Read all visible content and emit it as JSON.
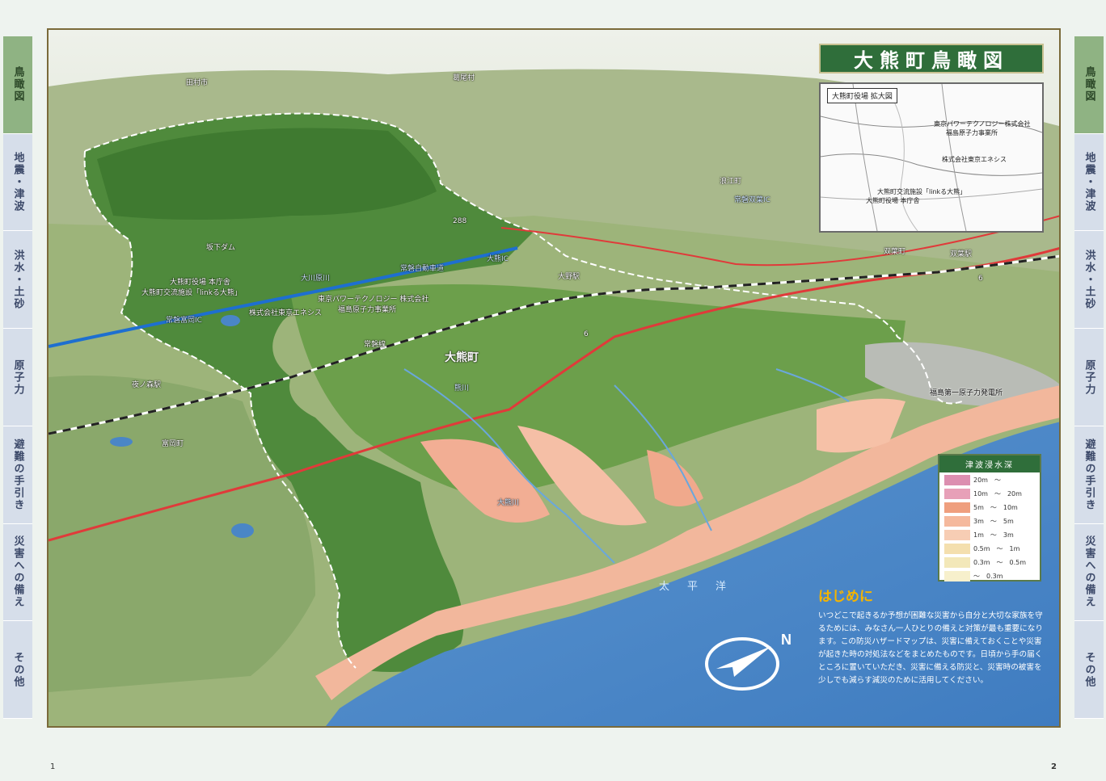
{
  "sidebar_left": [
    "鳥瞰図",
    "地震・津波",
    "洪水・土砂",
    "原子力",
    "避難の手引き",
    "災害への備え",
    "その他"
  ],
  "sidebar_right": [
    "鳥瞰図",
    "地震・津波",
    "洪水・土砂",
    "原子力",
    "避難の手引き",
    "災害への備え",
    "その他"
  ],
  "map_title": "大熊町鳥瞰図",
  "inset": {
    "title": "大熊町役場 拡大図",
    "labels": {
      "tepco_line1": "東京パワーテクノロジー株式会社",
      "tepco_line2": "福島原子力事業所",
      "enesys": "株式会社東京エネシス",
      "linkru": "大熊町交流施設「linkる大熊」",
      "office": "大熊町役場 本庁舎"
    }
  },
  "places": {
    "tamura": "田村市",
    "katsurao": "葛尾村",
    "namie": "浪江町",
    "futaba": "双葉町",
    "okuma": "大熊町",
    "tomioka": "富岡町",
    "sakashita_dam": "坂下ダム",
    "office1": "大熊町役場 本庁舎",
    "office2": "大熊町交流施設「linkる大熊」",
    "tepco1": "東京パワーテクノロジー 株式会社",
    "tepco2": "福島原子力事業所",
    "enesys": "株式会社東京エネシス",
    "ono_station": "大野駅",
    "futaba_station": "双葉駅",
    "yonomori_station": "夜ノ森駅",
    "joban_line": "常磐線",
    "expressway": "常磐自動車道",
    "okawa_river": "大川原川",
    "kuma_river": "熊川",
    "ouchi_river": "大熊川",
    "npp": "福島第一原子力発電所",
    "pacific": "太平洋",
    "route288": "288",
    "route6a": "6",
    "route6b": "6",
    "ic1": "常磐富岡IC",
    "ic2": "常磐双葉IC",
    "ic3": "大熊IC"
  },
  "legend": {
    "title": "津波浸水深",
    "rows": [
      {
        "label": "20m　～",
        "color": "#dc8fb0"
      },
      {
        "label": "10m　～　20m",
        "color": "#e7a0b8"
      },
      {
        "label": "5m　～　10m",
        "color": "#ef9f7e"
      },
      {
        "label": "3m　～　5m",
        "color": "#f5b99d"
      },
      {
        "label": "1m　～　3m",
        "color": "#f7cdb4"
      },
      {
        "label": "0.5m　～　1m",
        "color": "#f4dfae"
      },
      {
        "label": "0.3m　～　0.5m",
        "color": "#f3e8b9"
      },
      {
        "label": "～　0.3m",
        "color": "#f7f0cc"
      }
    ]
  },
  "intro": {
    "heading": "はじめに",
    "body": "いつどこで起きるか予想が困難な災害から自分と大切な家族を守るためには、みなさん一人ひとりの備えと対策が最も重要になります。この防災ハザードマップは、災害に備えておくことや災害が起きた時の対処法などをまとめたものです。日頃から手の届くところに置いていただき、災害に備える防災と、災害時の被害を少しでも減らす減災のために活用してください。"
  },
  "compass_label": "N",
  "page_left": "1",
  "page_right": "2"
}
